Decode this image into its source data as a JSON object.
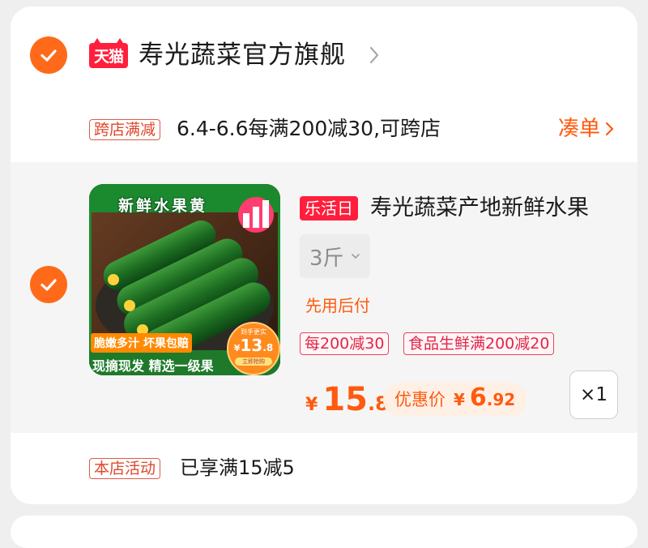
{
  "store": {
    "logo_text": "天猫",
    "name": "寿光蔬菜官方旗舰"
  },
  "promo": {
    "tag": "跨店满减",
    "text": "6.4-6.6每满200减30,可跨店",
    "action": "凑单"
  },
  "product": {
    "image": {
      "title": "新鲜水果黄",
      "tag1": "脆嫩多汁 坏果包赔",
      "tag2": "现摘现发 精选一级果",
      "price_label": "到手更实",
      "price_yen": "¥",
      "price_int": "13",
      "price_dec": ".8",
      "price_button": "立即抢购"
    },
    "activity_tag": "乐活日",
    "title": "寿光蔬菜产地新鲜水果",
    "spec": "3斤",
    "pay_later": "先用后付",
    "coupons": [
      "每200减30",
      "食品生鲜满200减20"
    ],
    "price": {
      "yen": "¥",
      "int": "15",
      "dec": ".8"
    },
    "discount": {
      "label": "优惠价",
      "yen": "¥",
      "int": "6",
      "dec": ".92"
    },
    "quantity": "×1"
  },
  "shop_activity": {
    "tag": "本店活动",
    "text": "已享满15减5"
  },
  "colors": {
    "accent": "#ff5a0f",
    "check": "#ff6a1a",
    "tmall_red": "#ff1f3d"
  }
}
